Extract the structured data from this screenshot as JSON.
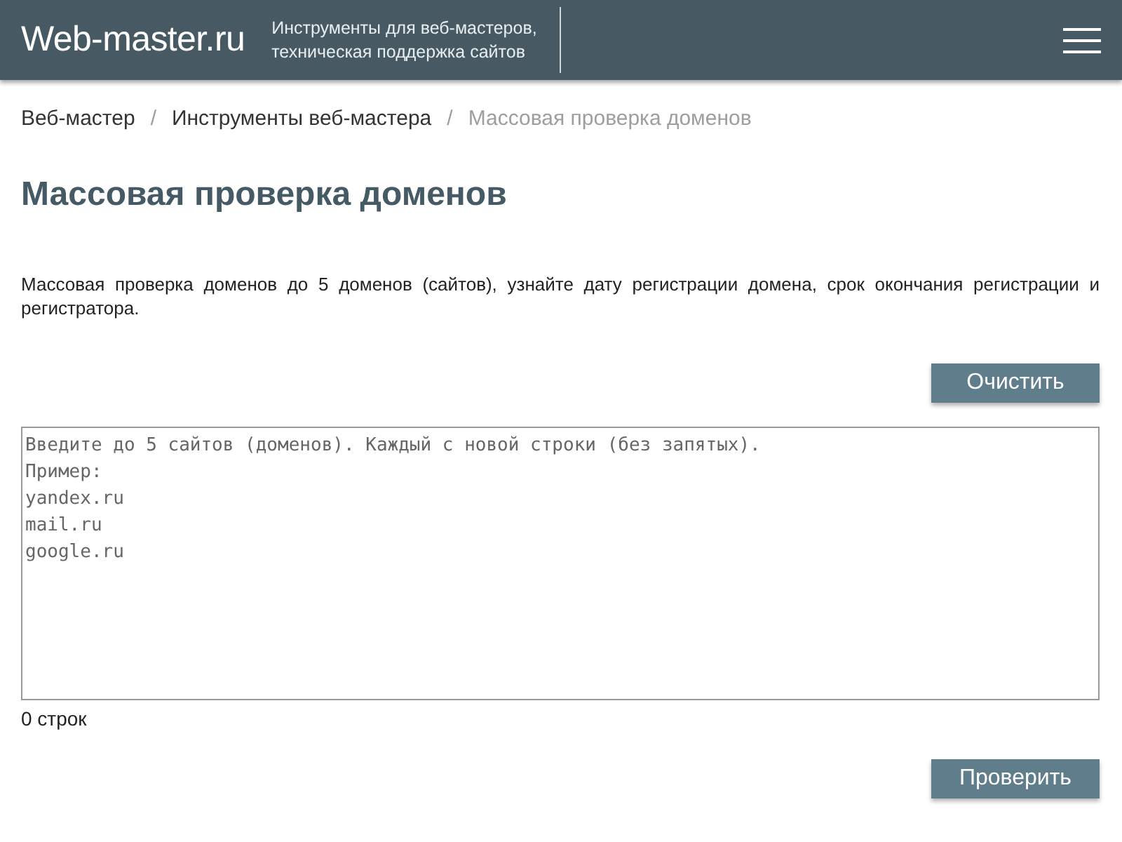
{
  "header": {
    "logo": "Web-master.ru",
    "tagline": "Инструменты для веб-мастеров,\nтехническая поддержка сайтов"
  },
  "breadcrumbs": [
    {
      "label": "Веб-мастер",
      "current": false
    },
    {
      "label": "Инструменты веб-мастера",
      "current": false
    },
    {
      "label": "Массовая проверка доменов",
      "current": true
    }
  ],
  "breadcrumb_separator": "/",
  "title": "Массовая проверка доменов",
  "description": "Массовая проверка доменов до 5 доменов (сайтов), узнайте дату регистрации домена, срок окончания регистрации и регистратора.",
  "clear_button": "Очистить",
  "domains_field": {
    "placeholder": "Введите до 5 сайтов (доменов). Каждый с новой строки (без запятых).\nПример:\nyandex.ru\nmail.ru\ngoogle.ru"
  },
  "line_count": "0 строк",
  "check_button": "Проверить"
}
